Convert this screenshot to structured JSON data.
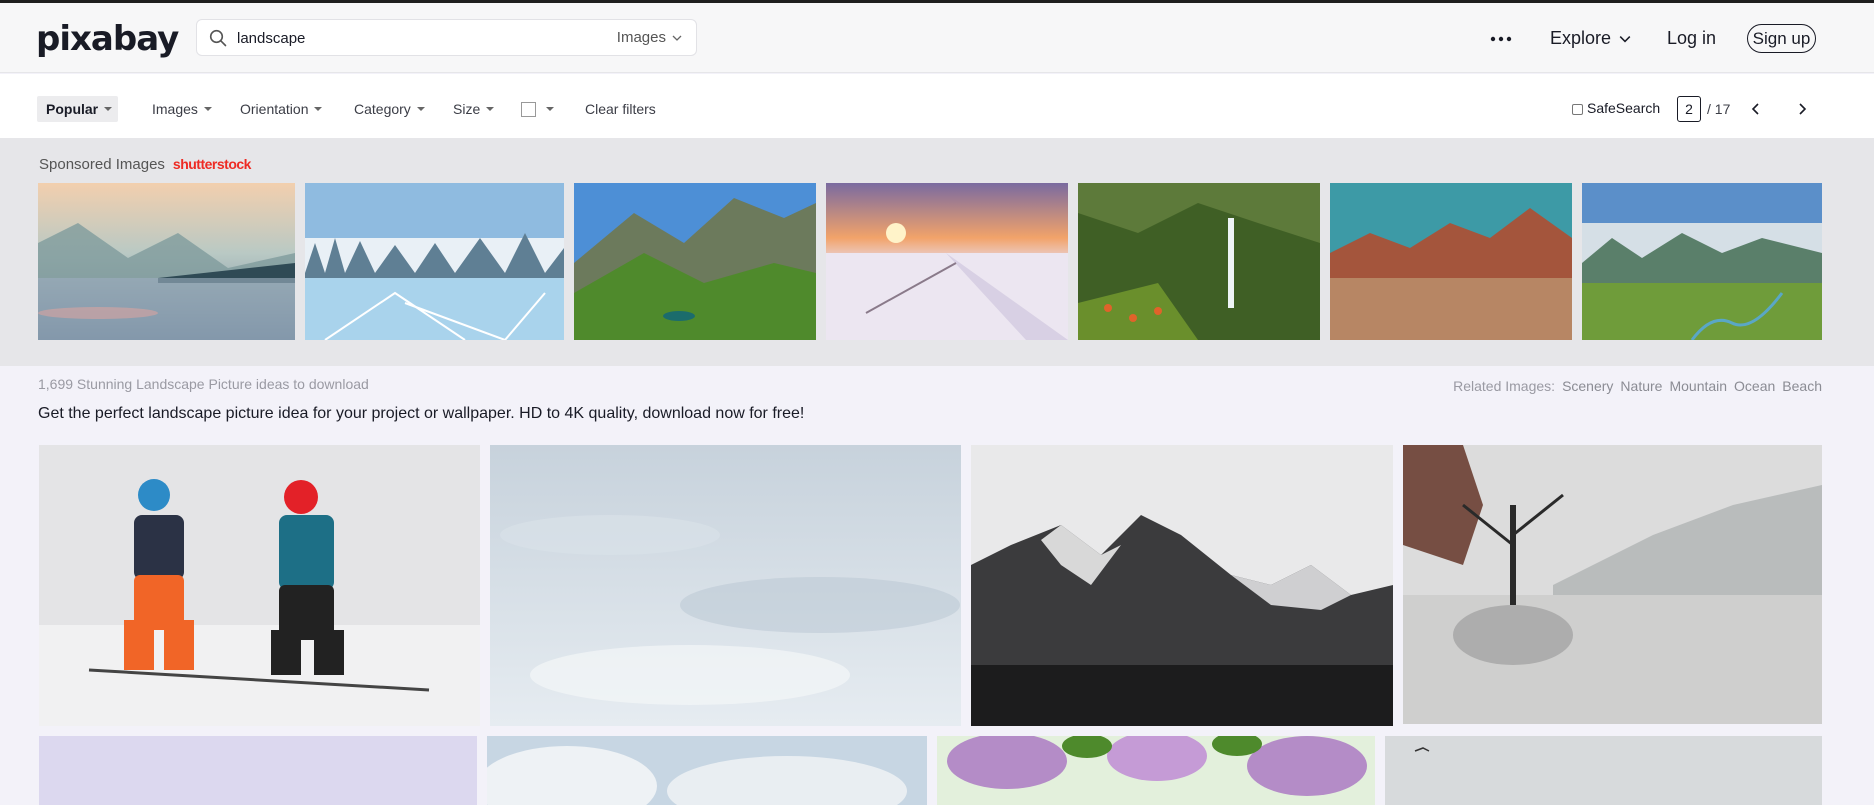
{
  "header": {
    "logo": "pixabay",
    "search_value": "landscape",
    "search_type": "Images",
    "explore_label": "Explore",
    "login_label": "Log in",
    "signup_label": "Sign up"
  },
  "filters": {
    "sort": "Popular",
    "media": "Images",
    "orientation": "Orientation",
    "category": "Category",
    "size": "Size",
    "clear": "Clear filters",
    "safesearch": "SafeSearch",
    "page_current": "2",
    "page_total": "/ 17"
  },
  "sponsored": {
    "label": "Sponsored Images",
    "brand": "shutterstock"
  },
  "results": {
    "count_text": "1,699 Stunning Landscape Picture ideas to download",
    "related_label": "Related Images:",
    "related": [
      "Scenery",
      "Nature",
      "Mountain",
      "Ocean",
      "Beach"
    ],
    "tagline": "Get the perfect landscape picture idea for your project or wallpaper. HD to 4K quality, download now for free!"
  },
  "colors": {
    "accent": "#191b26",
    "brand_red": "#ee2b24",
    "muted": "#9a9aa3"
  },
  "icons": [
    "search-icon",
    "chevron-down-icon",
    "more-dots-icon",
    "chevron-left-icon",
    "chevron-right-icon"
  ]
}
